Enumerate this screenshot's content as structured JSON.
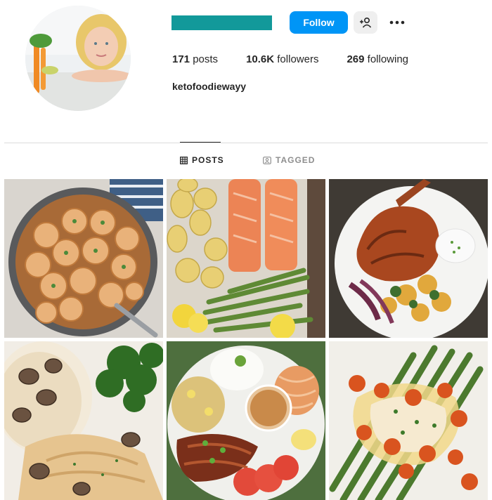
{
  "profile": {
    "username": "ketofoodiewayy",
    "follow_label": "Follow",
    "suggest_icon": "add-person-icon",
    "more_icon": "more-horizontal-icon",
    "stats": {
      "posts_value": "171",
      "posts_label": "posts",
      "followers_value": "10.6K",
      "followers_label": "followers",
      "following_value": "269",
      "following_label": "following"
    }
  },
  "tabs": [
    {
      "label": "POSTS",
      "icon": "grid-icon",
      "active": true
    },
    {
      "label": "TAGGED",
      "icon": "tagged-icon",
      "active": false
    }
  ],
  "colors": {
    "accent": "#0095f6",
    "username_redaction": "#12999a",
    "text": "#262626",
    "muted": "#8e8e8e"
  }
}
